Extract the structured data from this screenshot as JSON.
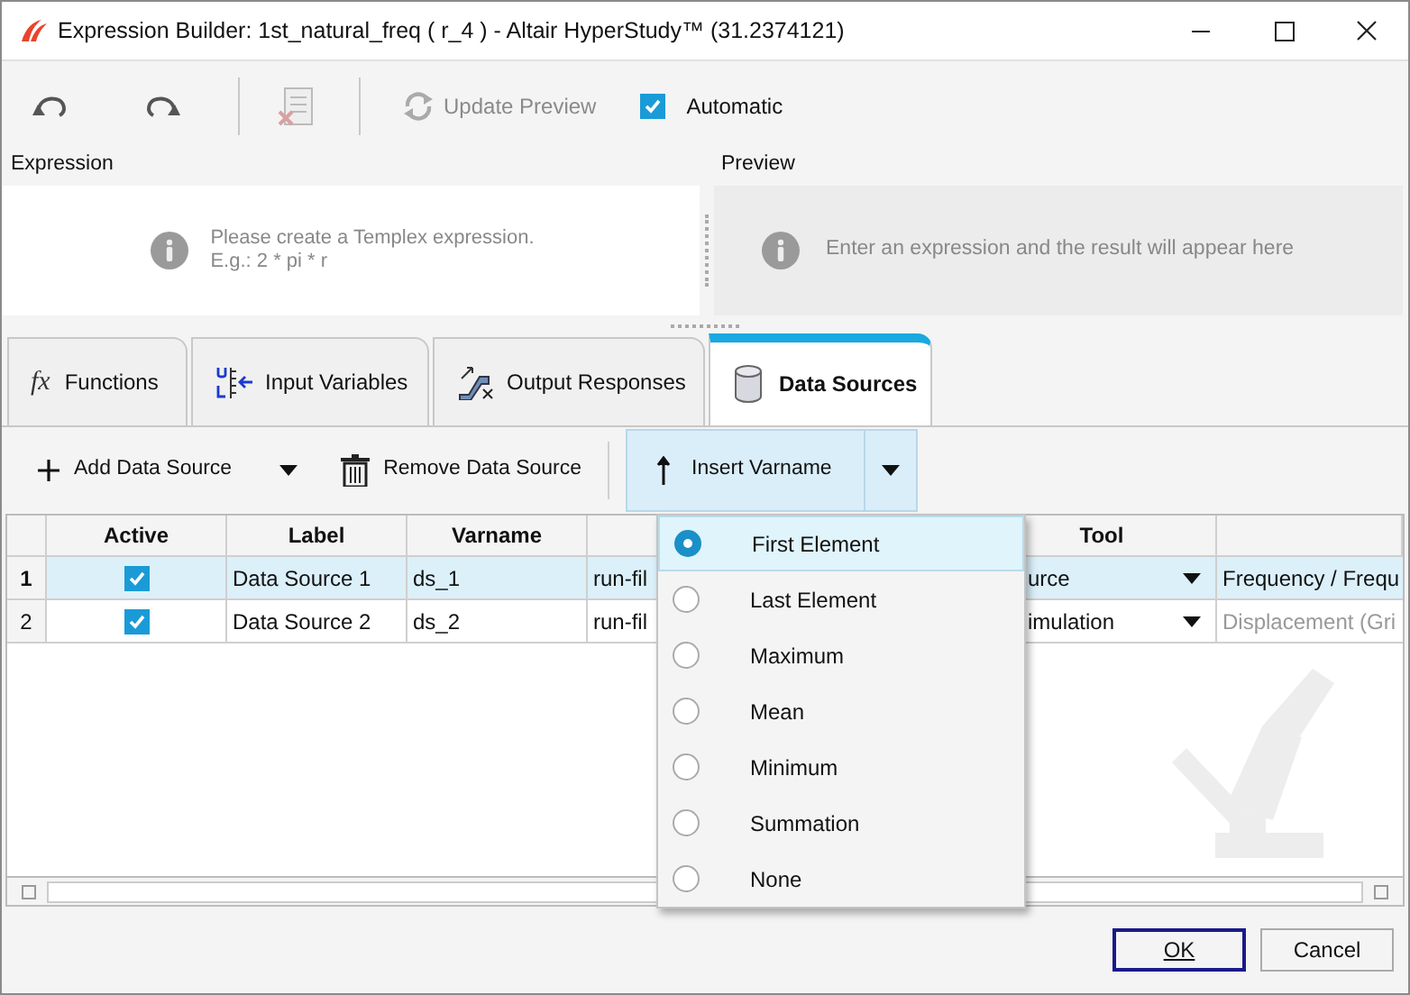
{
  "window": {
    "title": "Expression Builder: 1st_natural_freq ( r_4 ) - Altair HyperStudy™ (31.2374121)"
  },
  "toolbar": {
    "update_preview": {
      "label": "Update Preview",
      "disabled": true
    },
    "automatic": {
      "label": "Automatic",
      "checked": true
    }
  },
  "expression": {
    "label": "Expression",
    "message": "Please create a Templex expression.",
    "example": "E.g.: 2 * pi * r"
  },
  "preview": {
    "label": "Preview",
    "message": "Enter an expression and the result will appear here"
  },
  "tabs": [
    {
      "kind": "functions",
      "icon": "fx",
      "label": "Functions",
      "selected": false
    },
    {
      "kind": "inputs",
      "label": "Input Variables",
      "selected": false
    },
    {
      "kind": "outputs",
      "label": "Output Responses",
      "selected": false
    },
    {
      "kind": "sources",
      "label": "Data Sources",
      "selected": true
    }
  ],
  "actions": {
    "add": "Add Data Source",
    "remove": "Remove Data Source",
    "insert": "Insert Varname"
  },
  "table": {
    "columns": {
      "active": "Active",
      "label": "Label",
      "varname": "Varname",
      "tool": "Tool"
    },
    "rows": [
      {
        "number": "1",
        "selected": true,
        "active": true,
        "label": "Data Source 1",
        "varname": "ds_1",
        "column_5": "run-fil",
        "tool": "urce",
        "column_7": "Frequency / Frequ",
        "column_7_dimmed": false
      },
      {
        "number": "2",
        "selected": false,
        "active": true,
        "label": "Data Source 2",
        "varname": "ds_2",
        "column_5": "run-fil",
        "tool": "imulation",
        "column_7": "Displacement (Gri",
        "column_7_dimmed": true
      }
    ]
  },
  "menu": {
    "items": [
      {
        "label": "First Element",
        "selected": true
      },
      {
        "label": "Last Element",
        "selected": false
      },
      {
        "label": "Maximum",
        "selected": false
      },
      {
        "label": "Mean",
        "selected": false
      },
      {
        "label": "Minimum",
        "selected": false
      },
      {
        "label": "Summation",
        "selected": false
      },
      {
        "label": "None",
        "selected": false
      }
    ]
  },
  "buttons": [
    {
      "kind": "default",
      "label": "OK"
    },
    {
      "kind": "normal",
      "label": "Cancel"
    }
  ]
}
